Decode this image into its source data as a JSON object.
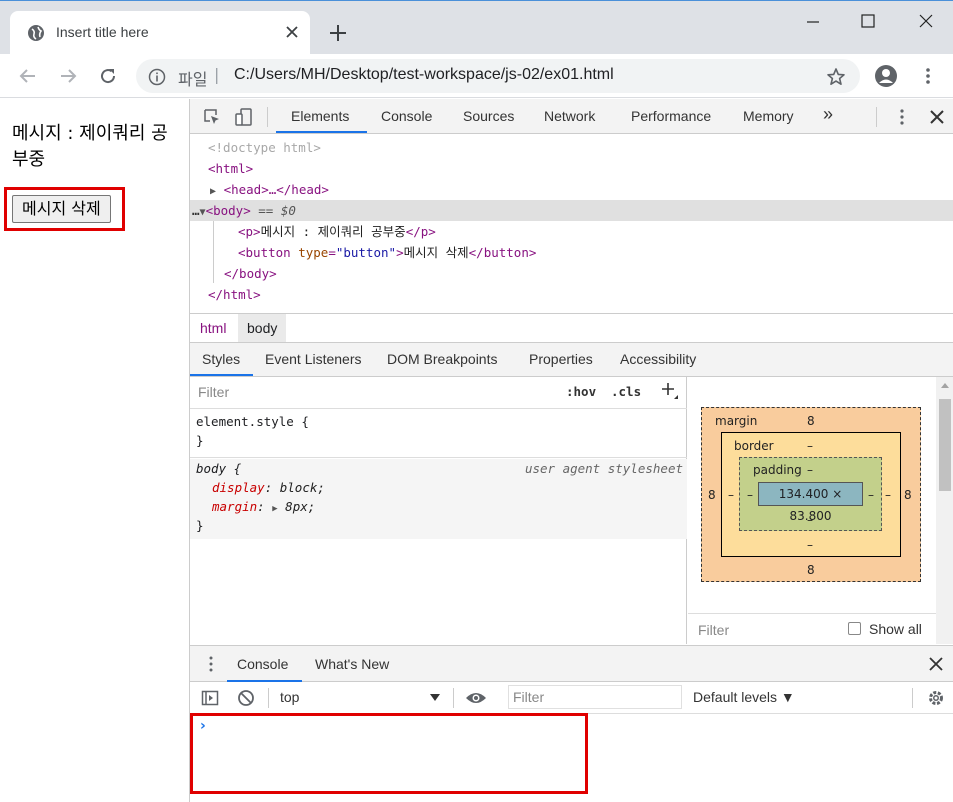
{
  "browser": {
    "tab_title": "Insert title here",
    "scheme_label": "파일",
    "url": "C:/Users/MH/Desktop/test-workspace/js-02/ex01.html"
  },
  "page": {
    "paragraph": "메시지 : 제이쿼리 공부중",
    "button_label": "메시지 삭제"
  },
  "devtools": {
    "tabs": [
      "Elements",
      "Console",
      "Sources",
      "Network",
      "Performance",
      "Memory"
    ],
    "more_tabs": "»",
    "dom": {
      "doctype": "<!doctype html>",
      "html_open": "<html>",
      "head_collapsed": "<head>…</head>",
      "body_open": "<body>",
      "body_marker": "== $0",
      "p_line_tag_open": "<p>",
      "p_line_text": "메시지 : 제이쿼리 공부중",
      "p_line_tag_close": "</p>",
      "button_tag_open": "<button",
      "button_attr_name": "type",
      "button_attr_value": "\"button\"",
      "button_text": "메시지 삭제",
      "button_tag_close": "</button>",
      "body_close": "</body>",
      "html_close": "</html>"
    },
    "breadcrumbs": [
      "html",
      "body"
    ],
    "subtabs": [
      "Styles",
      "Event Listeners",
      "DOM Breakpoints",
      "Properties",
      "Accessibility"
    ],
    "styles": {
      "filter_placeholder": "Filter",
      "hov": ":hov",
      "cls": ".cls",
      "element_style_open": "element.style {",
      "element_style_close": "}",
      "body_selector": "body {",
      "body_source": "user agent stylesheet",
      "decl1_prop": "display",
      "decl1_val": "block;",
      "decl2_prop": "margin",
      "decl2_val": "8px;",
      "body_close": "}"
    },
    "box_model": {
      "margin_label": "margin",
      "margin_top": "8",
      "margin_bottom": "8",
      "margin_left": "8",
      "margin_right": "8",
      "border_label": "border",
      "border_top": "–",
      "border_bottom": "–",
      "border_left": "–",
      "border_right": "–",
      "padding_label": "padding",
      "padding_top": "–",
      "padding_bottom": "–",
      "padding_left": "–",
      "padding_right": "–",
      "content": "134.400 × 83.800",
      "filter_placeholder": "Filter",
      "show_all": "Show all"
    },
    "drawer": {
      "tabs": [
        "Console",
        "What's New"
      ],
      "context": "top",
      "filter_placeholder": "Filter",
      "levels": "Default levels ▼",
      "prompt": "›"
    }
  },
  "colors": {
    "accent": "#1a73e8",
    "highlight": "#e00000",
    "tag": "#881280",
    "attr": "#994500",
    "value": "#1a1aa6"
  }
}
